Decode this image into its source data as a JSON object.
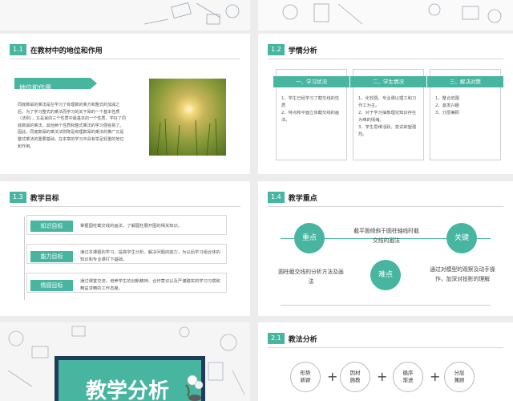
{
  "colors": {
    "accent": "#47b5a0",
    "text": "#222222"
  },
  "s11": {
    "num": "1.1",
    "title": "在教材中的地位和作用",
    "tag": "地位和作用",
    "body": "同底数幂的乘法是在学习了有理数的乘方和整式的加减之后，为了学习整式的乘法而学习的关于幂的一个基本性质（法则），又是幂的三个性质中最基本的一个性质，学好了同底数幂的乘法，其他两个性质和整式乘法的学习便容易了。因此，同底数幂的乘法法则既是有理数幂的乘法的推广又是整式乘法的重要基础，在本章的学习中具有举足轻重的地位和作用。"
  },
  "s12": {
    "num": "1.2",
    "title": "学情分析",
    "cols": [
      {
        "title": "一、学习状况",
        "body": "1、学生已经学习了截交线的性质\n2、特点和平面立体截交线的画法。"
      },
      {
        "title": "二、学生情况",
        "body": "1、化较弱，专业课以理工和习作工为主。\n2、对于学习抽象理论知识存在为难的情绪。\n3、学生思维活跃，尝试欲望强烈。"
      },
      {
        "title": "三、解决对策",
        "body": "1、整合范围\n2、激发兴趣\n3、分层兼顾"
      }
    ]
  },
  "s13": {
    "num": "1.3",
    "title": "教学目标",
    "goals": [
      {
        "label": "知识目标",
        "text": "掌握圆柱截交线的画法，了解圆柱展开图的相关知识。"
      },
      {
        "label": "能力目标",
        "text": "通过本课题的学习，提高学生分析、解决问题的能力，为以后学习组合体的知识和专业课打下基础。"
      },
      {
        "label": "情感目标",
        "text": "通过课堂交流，培养学生的创新精神、合作意识以及严谨踏实的学习习惯和精益求精的工作态度。"
      }
    ]
  },
  "s14": {
    "num": "1.4",
    "title": "教学重点",
    "key1": "重点",
    "key2": "关键",
    "key3": "难点",
    "t_top": "截平面倾斜于圆柱轴线时截交线的画法",
    "t_left": "圆柱截交线的分析方法及画法",
    "t_right": "通过对模型的观察及动手操作，加深对投影的理解"
  },
  "s_cover": {
    "title": "教学分析"
  },
  "s21": {
    "num": "2.1",
    "title": "教法分析",
    "methods": [
      "形势\n新颖",
      "因材\n施教",
      "循序\n渐进",
      "分层\n兼顾"
    ]
  }
}
